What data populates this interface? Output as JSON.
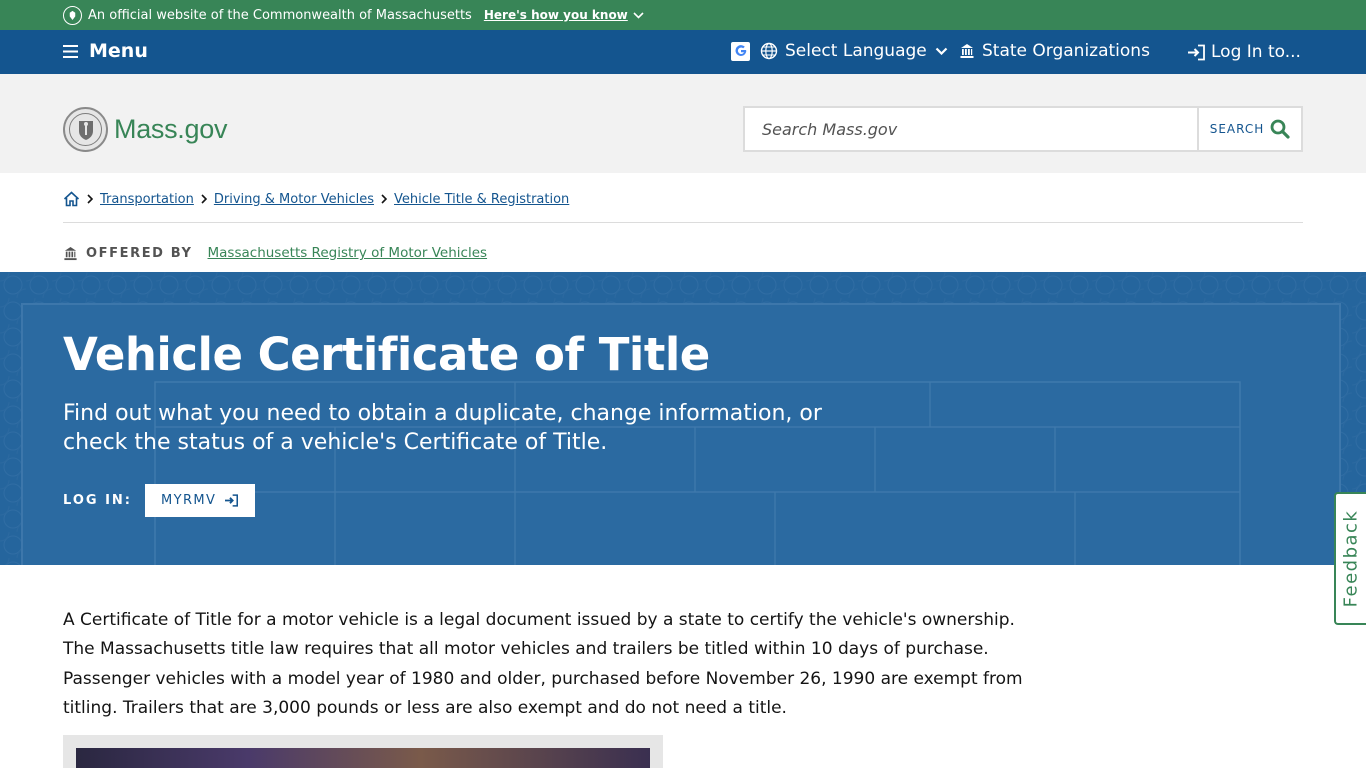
{
  "official_banner": {
    "text": "An official website of the Commonwealth of Massachusetts",
    "how_link": "Here's how you know"
  },
  "utility_nav": {
    "menu": "Menu",
    "language": "Select Language",
    "state_orgs": "State Organizations",
    "login": "Log In to..."
  },
  "header": {
    "logo_text": "Mass.gov",
    "search_placeholder": "Search Mass.gov",
    "search_button": "SEARCH"
  },
  "breadcrumbs": [
    "Transportation",
    "Driving & Motor Vehicles",
    "Vehicle Title & Registration"
  ],
  "offered_by": {
    "label": "OFFERED BY",
    "org": "Massachusetts Registry of Motor Vehicles"
  },
  "hero": {
    "title": "Vehicle Certificate of Title",
    "subtitle": "Find out what you need to obtain a duplicate, change information, or check the status of a vehicle's Certificate of Title.",
    "login_label": "LOG IN:",
    "login_button": "MYRMV"
  },
  "intro_text": "A Certificate of Title for a motor vehicle is a legal document issued by a state to certify the vehicle's ownership. The Massachusetts title law requires that all motor vehicles and trailers be titled within 10 days of purchase. Passenger vehicles with a model year of 1980 and older, purchased before November 26, 1990 are exempt from titling. Trailers that are 3,000 pounds or less are also exempt and do not need a title.",
  "feedback": "Feedback",
  "colors": {
    "green": "#388557",
    "blue": "#14558f",
    "header_bg": "#f2f2f2"
  }
}
